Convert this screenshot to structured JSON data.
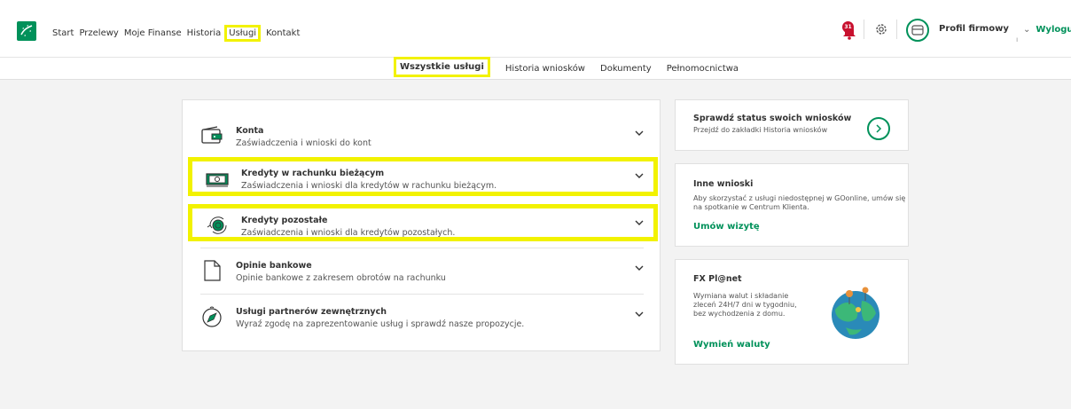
{
  "nav": {
    "items": [
      "Start",
      "Przelewy",
      "Moje Finanse",
      "Historia",
      "Usługi",
      "Kontakt"
    ],
    "notifications_count": "31",
    "profile_label": "Profil firmowy",
    "logout_label": "Wylogu"
  },
  "subtabs": [
    "Wszystkie usługi",
    "Historia wniosków",
    "Dokumenty",
    "Pełnomocnictwa"
  ],
  "services": [
    {
      "title": "Konta",
      "desc": "Zaświadczenia i wnioski do kont",
      "icon": "wallet-icon"
    },
    {
      "title": "Kredyty w rachunku bieżącym",
      "desc": "Zaświadczenia i wnioski dla kredytów w rachunku bieżącym.",
      "icon": "banknote-icon"
    },
    {
      "title": "Kredyty pozostałe",
      "desc": "Zaświadczenia i wnioski dla kredytów pozostałych.",
      "icon": "coins-cycle-icon"
    },
    {
      "title": "Opinie bankowe",
      "desc": "Opinie bankowe z zakresem obrotów na rachunku",
      "icon": "document-icon"
    },
    {
      "title": "Usługi partnerów zewnętrznych",
      "desc": "Wyraź zgodę na zaprezentowanie usług i sprawdź nasze propozycje.",
      "icon": "compass-icon"
    }
  ],
  "status_card": {
    "title": "Sprawdź status swoich wniosków",
    "desc": "Przejdź do zakładki Historia wniosków"
  },
  "other_card": {
    "title": "Inne wnioski",
    "desc": "Aby skorzystać z usługi niedostępnej w GOonline, umów się na spotkanie w Centrum Klienta.",
    "link": "Umów wizytę"
  },
  "fx_card": {
    "title": "FX Pl@net",
    "desc": "Wymiana walut i składanie zleceń 24H/7 dni w tygodniu, bez wychodzenia z domu.",
    "link": "Wymień waluty"
  },
  "colors": {
    "accent": "#00915a",
    "highlight": "#f2f200",
    "badge": "#c8102e",
    "background": "#f3f3f3"
  }
}
